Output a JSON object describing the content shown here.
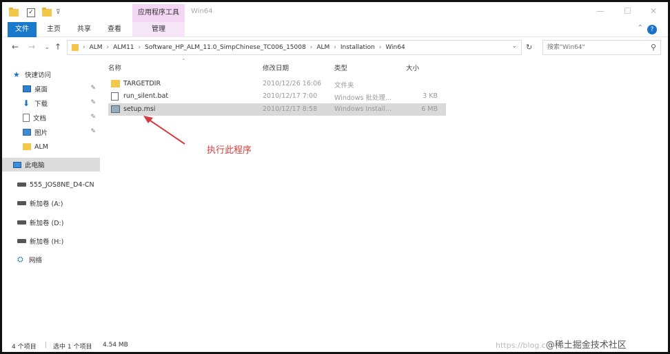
{
  "window": {
    "context_tab_header": "应用程序工具",
    "title": "Win64",
    "quick_access_check": "✓",
    "quick_access_dropdown": "⊽"
  },
  "ribbon": {
    "tabs": [
      "文件",
      "主页",
      "共享",
      "查看",
      "管理"
    ]
  },
  "address": {
    "crumbs": [
      "ALM",
      "ALM11",
      "Software_HP_ALM_11.0_SimpChinese_TC006_15008",
      "ALM",
      "Installation",
      "Win64"
    ],
    "search_placeholder": "搜索\"Win64\""
  },
  "nav": {
    "quick_access": "快速访问",
    "items": [
      {
        "label": "桌面",
        "icon": "desktop-icon",
        "pinned": true
      },
      {
        "label": "下载",
        "icon": "download-icon",
        "pinned": true
      },
      {
        "label": "文档",
        "icon": "document-icon",
        "pinned": true
      },
      {
        "label": "图片",
        "icon": "picture-icon",
        "pinned": true
      },
      {
        "label": "ALM",
        "icon": "folder-icon",
        "pinned": false
      }
    ],
    "this_pc": "此电脑",
    "network_drive": "555_JOS8NE_D4-CN",
    "drives": [
      "新加卷 (A:)",
      "新加卷 (D:)",
      "新加卷 (H:)"
    ],
    "network": "网络"
  },
  "columns": {
    "name": "名称",
    "date": "修改日期",
    "type": "类型",
    "size": "大小"
  },
  "files": [
    {
      "name": "TARGETDIR",
      "date": "2010/12/26 16:06",
      "type": "文件夹",
      "size": "",
      "icon": "folder-icon"
    },
    {
      "name": "run_silent.bat",
      "date": "2010/12/17 7:00",
      "type": "Windows 批处理...",
      "size": "3 KB",
      "icon": "batch-file-icon"
    },
    {
      "name": "setup.msi",
      "date": "2010/12/17 8:58",
      "type": "Windows Install...",
      "size": "6 MB",
      "icon": "msi-installer-icon"
    }
  ],
  "annotation": "执行此程序",
  "status": {
    "count": "4 个项目",
    "selected": "选中 1 个项目",
    "size": "4.54 MB"
  },
  "watermark": {
    "url": "https://blog.c",
    "text": "@稀土掘金技术社区"
  },
  "colors": {
    "file_tab": "#1979ca",
    "context_tab": "#f3d7f5",
    "annotation": "#d63b3b",
    "selected_row": "#d9d9d9"
  }
}
